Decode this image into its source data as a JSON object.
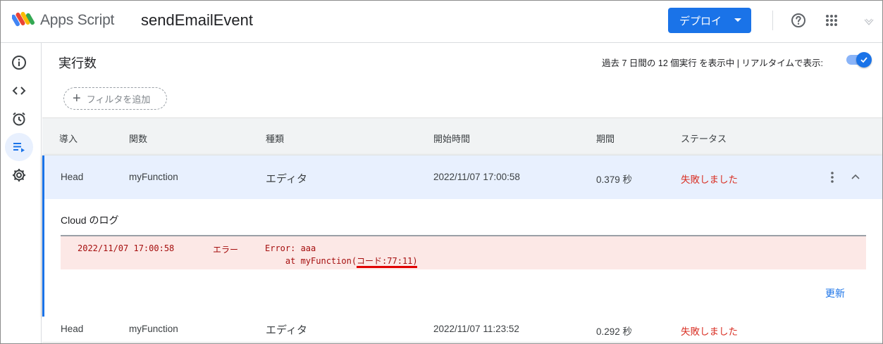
{
  "header": {
    "app_name": "Apps Script",
    "project_name": "sendEmailEvent",
    "deploy_label": "デプロイ"
  },
  "rail": {
    "items": [
      {
        "name": "overview",
        "icon": "info-icon"
      },
      {
        "name": "editor",
        "icon": "code-icon"
      },
      {
        "name": "triggers",
        "icon": "alarm-icon"
      },
      {
        "name": "executions",
        "icon": "executions-icon",
        "active": true
      },
      {
        "name": "settings",
        "icon": "gear-icon"
      }
    ]
  },
  "page": {
    "title": "実行数",
    "summary": "過去 7 日間の 12 個実行 を表示中  |  リアルタイムで表示:",
    "realtime_on": true,
    "filter_label": "フィルタを追加"
  },
  "table": {
    "columns": [
      "導入",
      "関数",
      "種類",
      "開始時間",
      "期間",
      "ステータス"
    ],
    "rows": [
      {
        "deployment": "Head",
        "function": "myFunction",
        "type": "エディタ",
        "start_time": "2022/11/07 17:00:58",
        "duration": "0.379 秒",
        "status": "失敗しました"
      },
      {
        "deployment": "Head",
        "function": "myFunction",
        "type": "エディタ",
        "start_time": "2022/11/07 11:23:52",
        "duration": "0.292 秒",
        "status": "失敗しました"
      }
    ]
  },
  "log": {
    "title": "Cloud のログ",
    "timestamp": "2022/11/07 17:00:58",
    "level": "エラー",
    "message_line1": "Error: aaa",
    "message_line2": "    at myFunction(コード:77:11)",
    "refresh_label": "更新"
  },
  "colors": {
    "primary": "#1a73e8",
    "error_text": "#d93025",
    "log_background": "#fce8e6",
    "highlight_underline": "#e00000"
  }
}
